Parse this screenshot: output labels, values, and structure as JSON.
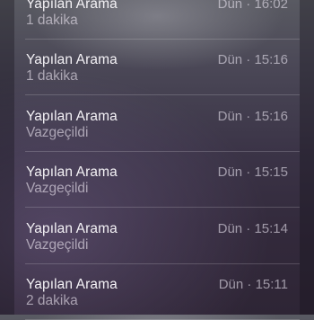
{
  "recent_calls": [
    {
      "type": "Yapılan Arama",
      "detail": "1 dakika",
      "time": "Dün · 16:02"
    },
    {
      "type": "Yapılan Arama",
      "detail": "1 dakika",
      "time": "Dün · 15:16"
    },
    {
      "type": "Yapılan Arama",
      "detail": "Vazgeçildi",
      "time": "Dün · 15:16"
    },
    {
      "type": "Yapılan Arama",
      "detail": "Vazgeçildi",
      "time": "Dün · 15:15"
    },
    {
      "type": "Yapılan Arama",
      "detail": "Vazgeçildi",
      "time": "Dün · 15:14"
    },
    {
      "type": "Yapılan Arama",
      "detail": "2 dakika",
      "time": "Dün · 15:11"
    }
  ]
}
